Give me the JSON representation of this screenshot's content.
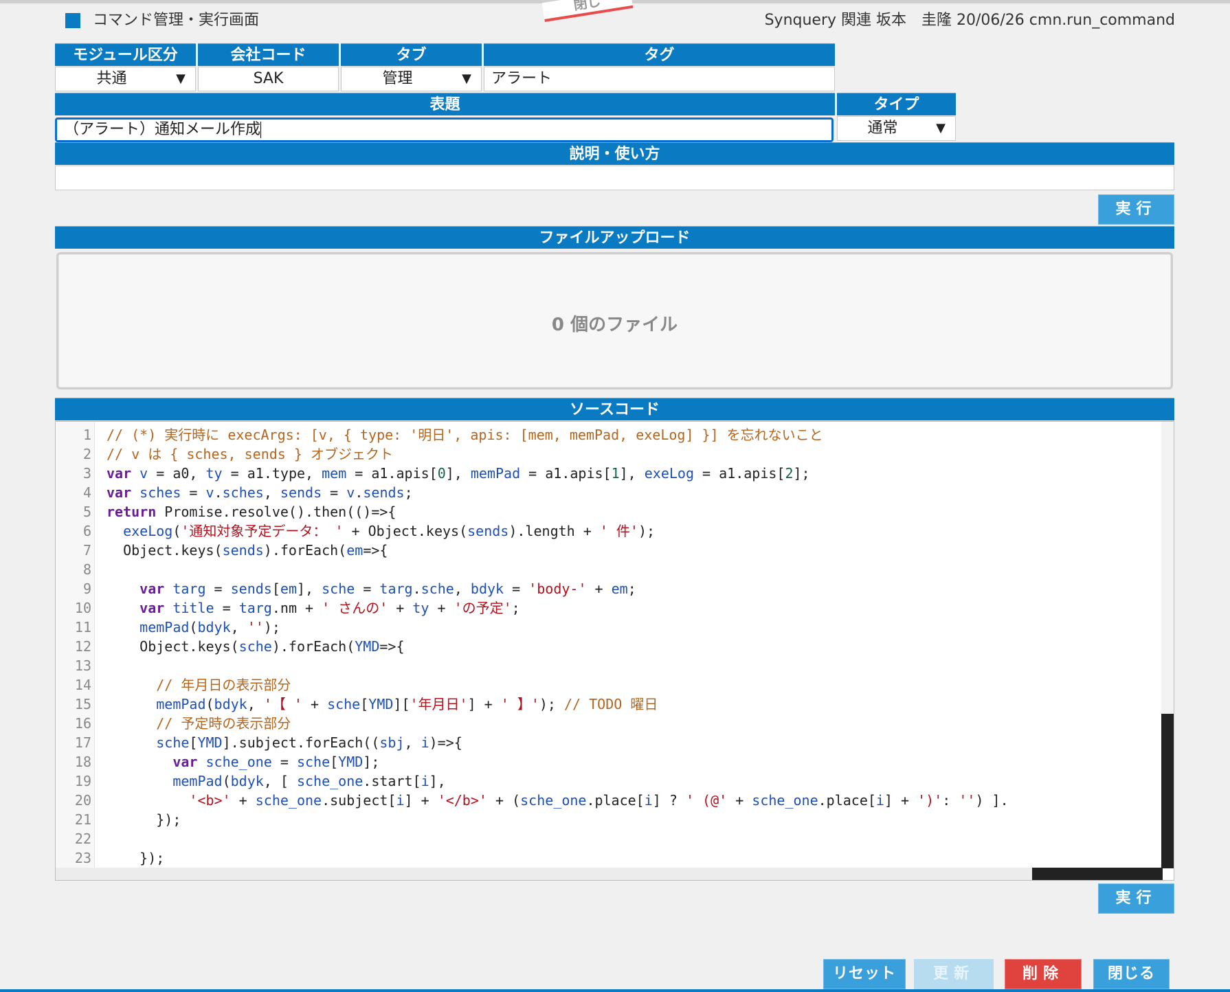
{
  "header": {
    "app_title": "コマンド管理・実行画面",
    "user_info": "Synquery 関連 坂本　圭隆 20/06/26 cmn.run_command",
    "ribbon_text": "閉じ"
  },
  "form": {
    "module": {
      "label": "モジュール区分",
      "value": "共通"
    },
    "company": {
      "label": "会社コード",
      "value": "SAK"
    },
    "tab": {
      "label": "タブ",
      "value": "管理"
    },
    "tag": {
      "label": "タグ",
      "value": "アラート"
    },
    "title": {
      "label": "表題",
      "value": "（アラート）通知メール作成"
    },
    "type": {
      "label": "タイプ",
      "value": "通常"
    },
    "description": {
      "label": "説明・使い方",
      "value": ""
    }
  },
  "buttons": {
    "run": "実行",
    "run_bottom": "実行",
    "reset": "リセット",
    "update": "更新",
    "delete": "削除",
    "close": "閉じる"
  },
  "upload": {
    "label": "ファイルアップロード",
    "count_text": "0 個のファイル"
  },
  "source": {
    "label": "ソースコード",
    "lines": [
      "// (*) 実行時に execArgs: [v, { type: '明日', apis: [mem, memPad, exeLog] }] を忘れないこと",
      "// v は { sches, sends } オブジェクト",
      "var v = a0, ty = a1.type, mem = a1.apis[0], memPad = a1.apis[1], exeLog = a1.apis[2];",
      "var sches = v.sches, sends = v.sends;",
      "return Promise.resolve().then(()=>{",
      "  exeLog('通知対象予定データ： ' + Object.keys(sends).length + ' 件');",
      "  Object.keys(sends).forEach(em=>{",
      "",
      "    var targ = sends[em], sche = targ.sche, bdyk = 'body-' + em;",
      "    var title = targ.nm + ' さんの' + ty + 'の予定';",
      "    memPad(bdyk, '');",
      "    Object.keys(sche).forEach(YMD=>{",
      "",
      "      // 年月日の表示部分",
      "      memPad(bdyk, '【 ' + sche[YMD]['年月日'] + ' 】'); // TODO 曜日",
      "      // 予定時の表示部分",
      "      sche[YMD].subject.forEach((sbj, i)=>{",
      "        var sche_one = sche[YMD];",
      "        memPad(bdyk, [ sche_one.start[i],",
      "          '<b>' + sche_one.subject[i] + '</b>' + (sche_one.place[i] ? ' (@' + sche_one.place[i] + ')': '') ].",
      "      });",
      "",
      "    });"
    ]
  },
  "colors": {
    "header_blue": "#0a7bc2",
    "button_blue": "#3aa0dc",
    "button_red": "#e0433d",
    "button_disabled": "#b7dcf0"
  }
}
